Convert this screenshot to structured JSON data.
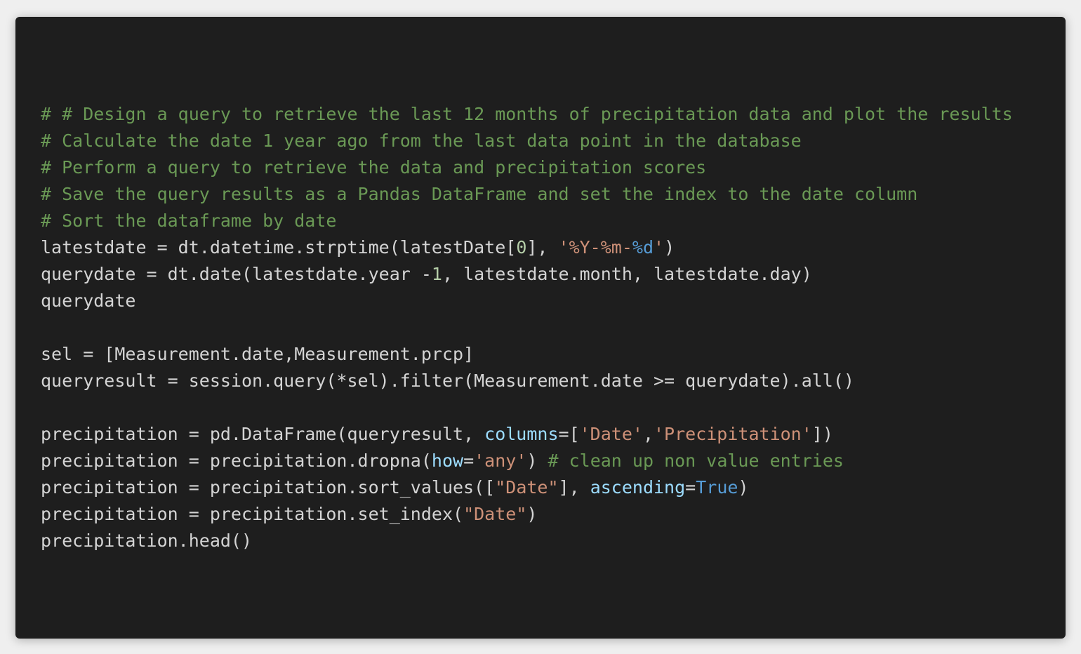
{
  "colors": {
    "background": "#1e1e1e",
    "page": "#efefef",
    "plain": "#d4d4d4",
    "comment": "#6a9955",
    "string": "#ce9178",
    "number": "#b5cea8",
    "keyword": "#569cd6",
    "param": "#9cdcfe"
  },
  "code_lines": [
    [
      {
        "t": "comment",
        "v": "# # Design a query to retrieve the last 12 months of precipitation data and plot the results"
      }
    ],
    [
      {
        "t": "comment",
        "v": "# Calculate the date 1 year ago from the last data point in the database"
      }
    ],
    [
      {
        "t": "comment",
        "v": "# Perform a query to retrieve the data and precipitation scores"
      }
    ],
    [
      {
        "t": "comment",
        "v": "# Save the query results as a Pandas DataFrame and set the index to the date column"
      }
    ],
    [
      {
        "t": "comment",
        "v": "# Sort the dataframe by date"
      }
    ],
    [
      {
        "t": "plain",
        "v": "latestdate = dt.datetime.strptime(latestDate["
      },
      {
        "t": "number",
        "v": "0"
      },
      {
        "t": "plain",
        "v": "], "
      },
      {
        "t": "string",
        "v": "'%Y-%m-"
      },
      {
        "t": "keyword",
        "v": "%d"
      },
      {
        "t": "string",
        "v": "'"
      },
      {
        "t": "plain",
        "v": ")"
      }
    ],
    [
      {
        "t": "plain",
        "v": "querydate = dt.date(latestdate.year -"
      },
      {
        "t": "number",
        "v": "1"
      },
      {
        "t": "plain",
        "v": ", latestdate.month, latestdate.day)"
      }
    ],
    [
      {
        "t": "plain",
        "v": "querydate"
      }
    ],
    [],
    [
      {
        "t": "plain",
        "v": "sel = [Measurement.date,Measurement.prcp]"
      }
    ],
    [
      {
        "t": "plain",
        "v": "queryresult = session.query(*sel).filter(Measurement.date >= querydate).all()"
      }
    ],
    [],
    [
      {
        "t": "plain",
        "v": "precipitation = pd.DataFrame(queryresult, "
      },
      {
        "t": "param",
        "v": "columns"
      },
      {
        "t": "plain",
        "v": "=["
      },
      {
        "t": "string",
        "v": "'Date'"
      },
      {
        "t": "plain",
        "v": ","
      },
      {
        "t": "string",
        "v": "'Precipitation'"
      },
      {
        "t": "plain",
        "v": "])"
      }
    ],
    [
      {
        "t": "plain",
        "v": "precipitation = precipitation.dropna("
      },
      {
        "t": "param",
        "v": "how"
      },
      {
        "t": "plain",
        "v": "="
      },
      {
        "t": "string",
        "v": "'any'"
      },
      {
        "t": "plain",
        "v": ") "
      },
      {
        "t": "comment",
        "v": "# clean up non value entries"
      }
    ],
    [
      {
        "t": "plain",
        "v": "precipitation = precipitation.sort_values(["
      },
      {
        "t": "string",
        "v": "\"Date\""
      },
      {
        "t": "plain",
        "v": "], "
      },
      {
        "t": "param",
        "v": "ascending"
      },
      {
        "t": "plain",
        "v": "="
      },
      {
        "t": "keyword",
        "v": "True"
      },
      {
        "t": "plain",
        "v": ")"
      }
    ],
    [
      {
        "t": "plain",
        "v": "precipitation = precipitation.set_index("
      },
      {
        "t": "string",
        "v": "\"Date\""
      },
      {
        "t": "plain",
        "v": ")"
      }
    ],
    [
      {
        "t": "plain",
        "v": "precipitation.head()"
      }
    ]
  ]
}
